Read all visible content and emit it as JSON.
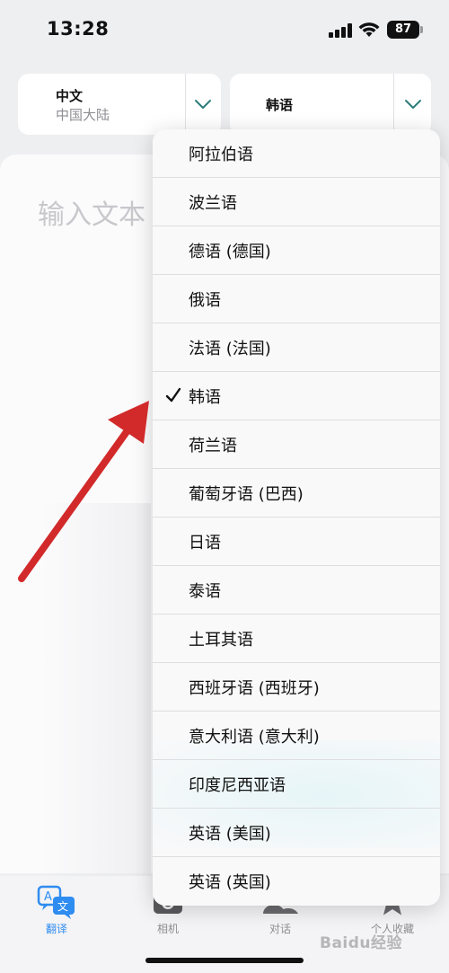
{
  "status_bar": {
    "time": "13:28",
    "battery": "87"
  },
  "source_language": {
    "name": "中文",
    "region": "中国大陆"
  },
  "target_language": {
    "name": "韩语"
  },
  "input": {
    "placeholder": "输入文本"
  },
  "language_menu": {
    "selected": "韩语",
    "items": [
      "阿拉伯语",
      "波兰语",
      "德语 (德国)",
      "俄语",
      "法语 (法国)",
      "韩语",
      "荷兰语",
      "葡萄牙语 (巴西)",
      "日语",
      "泰语",
      "土耳其语",
      "西班牙语 (西班牙)",
      "意大利语 (意大利)",
      "印度尼西亚语",
      "英语 (美国)",
      "英语 (英国)"
    ]
  },
  "tabs": [
    {
      "label": "翻译",
      "icon": "translate-icon",
      "active": true
    },
    {
      "label": "相机",
      "icon": "camera-icon",
      "active": false
    },
    {
      "label": "对话",
      "icon": "conversation-icon",
      "active": false
    },
    {
      "label": "个人收藏",
      "icon": "star-icon",
      "active": false
    }
  ],
  "watermark": "Baidu经验",
  "colors": {
    "accent": "#2f8cf0",
    "chevron": "#2e7d7a",
    "annotation_arrow": "#d22a2a"
  }
}
